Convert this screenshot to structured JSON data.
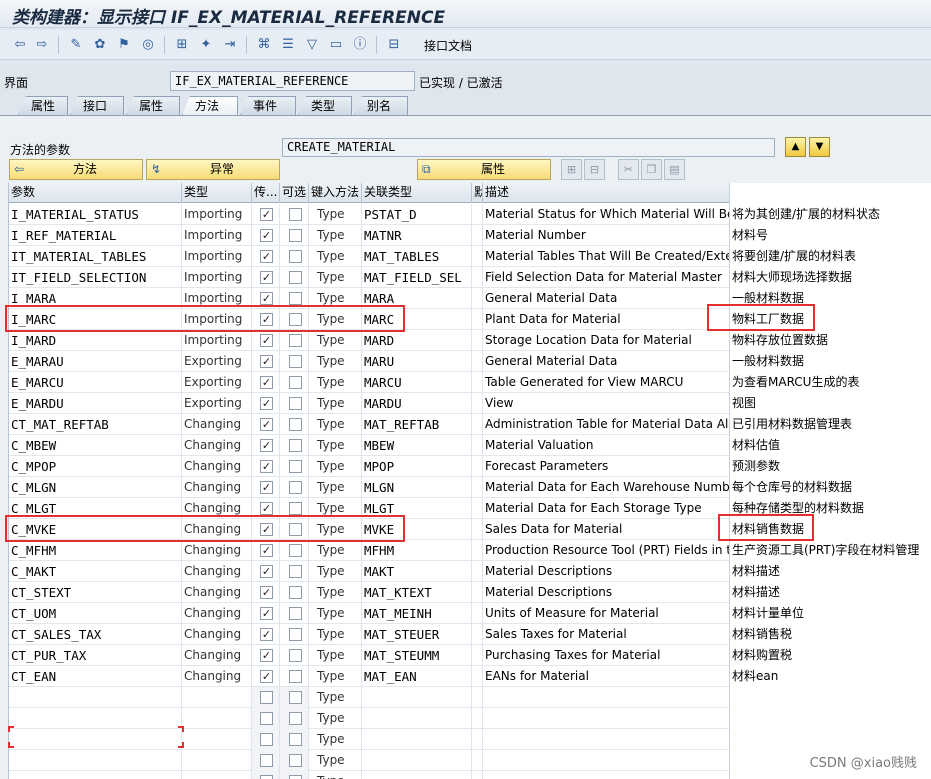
{
  "title": "类构建器：显示接口 IF_EX_MATERIAL_REFERENCE",
  "toolbar": {
    "interface_doc_label": "接口文档"
  },
  "interface": {
    "label": "界面",
    "name": "IF_EX_MATERIAL_REFERENCE",
    "status": "已实现 / 已激活"
  },
  "tabs": [
    "属性",
    "接口",
    "属性",
    "方法",
    "事件",
    "类型",
    "别名"
  ],
  "method": {
    "label": "方法的参数",
    "name": "CREATE_MATERIAL"
  },
  "buttons": {
    "methods": "方法",
    "exceptions": "异常",
    "attributes": "属性"
  },
  "columns": [
    "参数",
    "类型",
    "传...",
    "可选",
    "键入方法",
    "关联类型",
    "默",
    "描述"
  ],
  "rows": [
    {
      "param": "I_MATERIAL_STATUS",
      "type": "Importing",
      "pass": true,
      "opt": false,
      "typing": "Type",
      "ref": "PSTAT_D",
      "desc": "Material Status for Which Material Will Be Cr...",
      "desc_cn": "将为其创建/扩展的材料状态"
    },
    {
      "param": "I_REF_MATERIAL",
      "type": "Importing",
      "pass": true,
      "opt": false,
      "typing": "Type",
      "ref": "MATNR",
      "desc": "Material Number",
      "desc_cn": "材料号"
    },
    {
      "param": "IT_MATERIAL_TABLES",
      "type": "Importing",
      "pass": true,
      "opt": false,
      "typing": "Type",
      "ref": "MAT_TABLES",
      "desc": "Material Tables That Will Be Created/Exten...",
      "desc_cn": "将要创建/扩展的材料表"
    },
    {
      "param": "IT_FIELD_SELECTION",
      "type": "Importing",
      "pass": true,
      "opt": false,
      "typing": "Type",
      "ref": "MAT_FIELD_SEL",
      "desc": "Field Selection Data for Material Master",
      "desc_cn": "材料大师现场选择数据"
    },
    {
      "param": "I_MARA",
      "type": "Importing",
      "pass": true,
      "opt": false,
      "typing": "Type",
      "ref": "MARA",
      "desc": "General Material Data",
      "desc_cn": "一般材料数据"
    },
    {
      "param": "I_MARC",
      "type": "Importing",
      "pass": true,
      "opt": false,
      "typing": "Type",
      "ref": "MARC",
      "desc": "Plant Data for Material",
      "desc_cn": "物料工厂数据"
    },
    {
      "param": "I_MARD",
      "type": "Importing",
      "pass": true,
      "opt": false,
      "typing": "Type",
      "ref": "MARD",
      "desc": "Storage Location Data for Material",
      "desc_cn": "物料存放位置数据"
    },
    {
      "param": "E_MARAU",
      "type": "Exporting",
      "pass": true,
      "opt": false,
      "typing": "Type",
      "ref": "MARU",
      "desc": "General Material Data",
      "desc_cn": "一般材料数据"
    },
    {
      "param": "E_MARCU",
      "type": "Exporting",
      "pass": true,
      "opt": false,
      "typing": "Type",
      "ref": "MARCU",
      "desc": "Table Generated for View MARCU",
      "desc_cn": "为查看MARCU生成的表"
    },
    {
      "param": "E_MARDU",
      "type": "Exporting",
      "pass": true,
      "opt": false,
      "typing": "Type",
      "ref": "MARDU",
      "desc": "View",
      "desc_cn": "视图"
    },
    {
      "param": "CT_MAT_REFTAB",
      "type": "Changing",
      "pass": true,
      "opt": false,
      "typing": "Type",
      "ref": "MAT_REFTAB",
      "desc": "Administration Table for Material Data Alrea...",
      "desc_cn": "已引用材料数据管理表"
    },
    {
      "param": "C_MBEW",
      "type": "Changing",
      "pass": true,
      "opt": false,
      "typing": "Type",
      "ref": "MBEW",
      "desc": "Material Valuation",
      "desc_cn": "材料估值"
    },
    {
      "param": "C_MPOP",
      "type": "Changing",
      "pass": true,
      "opt": false,
      "typing": "Type",
      "ref": "MPOP",
      "desc": "Forecast Parameters",
      "desc_cn": "预测参数"
    },
    {
      "param": "C_MLGN",
      "type": "Changing",
      "pass": true,
      "opt": false,
      "typing": "Type",
      "ref": "MLGN",
      "desc": "Material Data for Each Warehouse Number",
      "desc_cn": "每个仓库号的材料数据"
    },
    {
      "param": "C_MLGT",
      "type": "Changing",
      "pass": true,
      "opt": false,
      "typing": "Type",
      "ref": "MLGT",
      "desc": "Material Data for Each Storage Type",
      "desc_cn": "每种存储类型的材料数据"
    },
    {
      "param": "C_MVKE",
      "type": "Changing",
      "pass": true,
      "opt": false,
      "typing": "Type",
      "ref": "MVKE",
      "desc": "Sales Data for Material",
      "desc_cn": "材料销售数据"
    },
    {
      "param": "C_MFHM",
      "type": "Changing",
      "pass": true,
      "opt": false,
      "typing": "Type",
      "ref": "MFHM",
      "desc": "Production Resource Tool (PRT) Fields in t...",
      "desc_cn": "生产资源工具(PRT)字段在材料管理"
    },
    {
      "param": "C_MAKT",
      "type": "Changing",
      "pass": true,
      "opt": false,
      "typing": "Type",
      "ref": "MAKT",
      "desc": "Material Descriptions",
      "desc_cn": "材料描述"
    },
    {
      "param": "CT_STEXT",
      "type": "Changing",
      "pass": true,
      "opt": false,
      "typing": "Type",
      "ref": "MAT_KTEXT",
      "desc": "Material Descriptions",
      "desc_cn": "材料描述"
    },
    {
      "param": "CT_UOM",
      "type": "Changing",
      "pass": true,
      "opt": false,
      "typing": "Type",
      "ref": "MAT_MEINH",
      "desc": "Units of Measure for Material",
      "desc_cn": "材料计量单位"
    },
    {
      "param": "CT_SALES_TAX",
      "type": "Changing",
      "pass": true,
      "opt": false,
      "typing": "Type",
      "ref": "MAT_STEUER",
      "desc": "Sales Taxes for Material",
      "desc_cn": "材料销售税"
    },
    {
      "param": "CT_PUR_TAX",
      "type": "Changing",
      "pass": true,
      "opt": false,
      "typing": "Type",
      "ref": "MAT_STEUMM",
      "desc": "Purchasing Taxes for Material",
      "desc_cn": "材料购置税"
    },
    {
      "param": "CT_EAN",
      "type": "Changing",
      "pass": true,
      "opt": false,
      "typing": "Type",
      "ref": "MAT_EAN",
      "desc": "EANs for Material",
      "desc_cn": "材料ean"
    },
    {
      "param": "",
      "type": "",
      "pass": false,
      "opt": false,
      "typing": "Type",
      "ref": "",
      "desc": "",
      "desc_cn": ""
    },
    {
      "param": "",
      "type": "",
      "pass": false,
      "opt": false,
      "typing": "Type",
      "ref": "",
      "desc": "",
      "desc_cn": ""
    },
    {
      "param": "",
      "type": "",
      "pass": false,
      "opt": false,
      "typing": "Type",
      "ref": "",
      "desc": "",
      "desc_cn": ""
    },
    {
      "param": "",
      "type": "",
      "pass": false,
      "opt": false,
      "typing": "Type",
      "ref": "",
      "desc": "",
      "desc_cn": ""
    },
    {
      "param": "",
      "type": "",
      "pass": false,
      "opt": false,
      "typing": "Type",
      "ref": "",
      "desc": "",
      "desc_cn": ""
    }
  ],
  "highlighted_params": [
    "I_MARC",
    "C_MVKE"
  ],
  "highlight_color": "#e3302f",
  "watermark": "CSDN @xiao贱贱"
}
